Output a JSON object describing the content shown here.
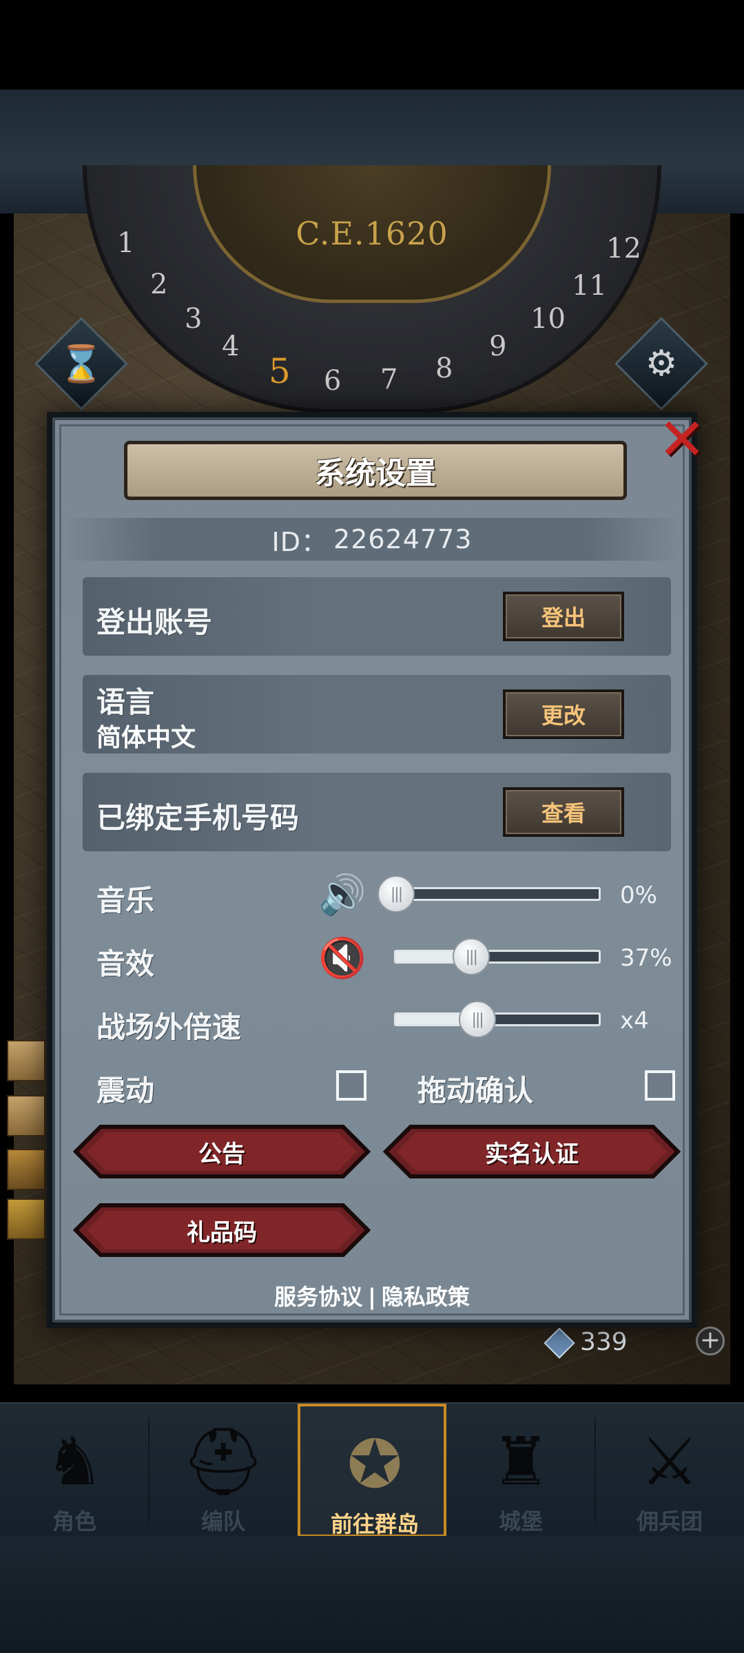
{
  "background": {
    "era": "C.E.1620",
    "dial_numbers": [
      "1",
      "2",
      "3",
      "4",
      "5",
      "6",
      "7",
      "8",
      "9",
      "10",
      "11",
      "12"
    ],
    "active_number": "5",
    "gems": "339"
  },
  "dialog": {
    "title": "系统设置",
    "id_label": "ID：",
    "id_value": "22624773",
    "rows": [
      {
        "label": "登出账号",
        "button": "登出"
      },
      {
        "label": "语言",
        "sub": "简体中文",
        "button": "更改"
      },
      {
        "label": "已绑定手机号码",
        "button": "查看"
      }
    ],
    "music": {
      "label": "音乐",
      "value": "0%",
      "level": 0
    },
    "sfx": {
      "label": "音效",
      "value": "37%",
      "level": 0.37
    },
    "speed": {
      "label": "战场外倍速",
      "value": "x4",
      "level": 0.4
    },
    "vibration": {
      "label": "震动",
      "checked": false
    },
    "drag_confirm": {
      "label": "拖动确认",
      "checked": false
    },
    "buttons": {
      "notice": "公告",
      "realname": "实名认证",
      "gift_code": "礼品码"
    },
    "footer": {
      "terms": "服务协议",
      "separator": "|",
      "privacy": "隐私政策"
    }
  },
  "nav": [
    {
      "label": "角色",
      "icon": "knight-icon"
    },
    {
      "label": "编队",
      "icon": "helmet-icon"
    },
    {
      "label": "前往群岛",
      "icon": "compass-icon",
      "active": true
    },
    {
      "label": "城堡",
      "icon": "castle-icon"
    },
    {
      "label": "佣兵团",
      "icon": "sword-icon"
    }
  ],
  "colors": {
    "accent_gold": "#f7c57a",
    "close_red": "#c52222",
    "active_border": "#c98a22"
  }
}
